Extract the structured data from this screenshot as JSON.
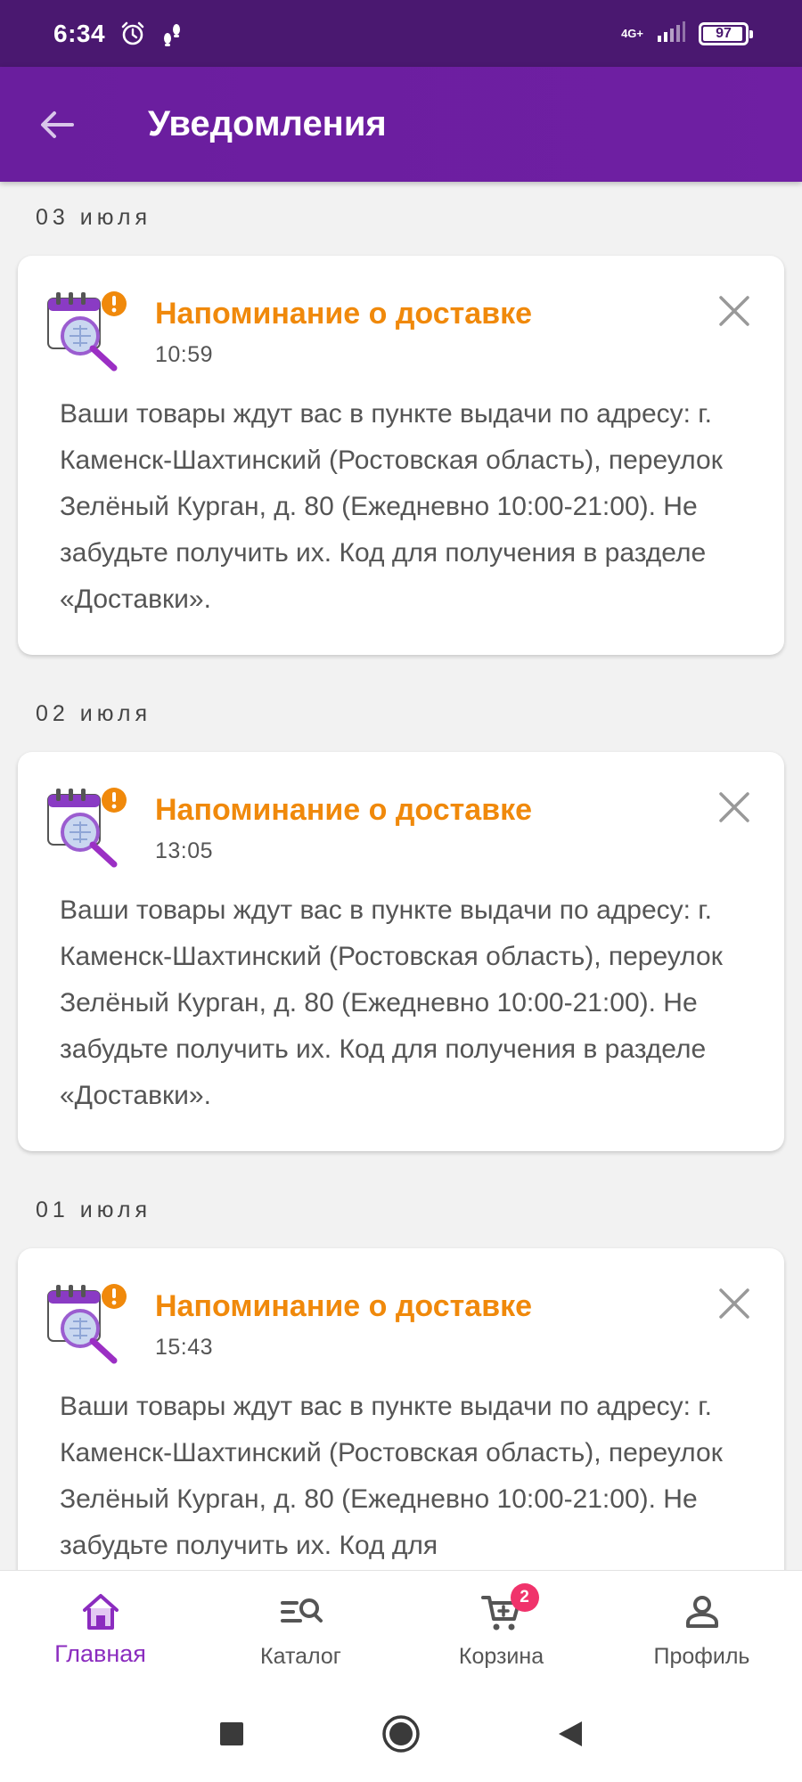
{
  "status_bar": {
    "time": "6:34",
    "network": "4G+",
    "battery": "97",
    "icons": [
      "alarm-icon",
      "footsteps-icon",
      "signal-icon",
      "battery-icon"
    ]
  },
  "app_bar": {
    "title": "Уведомления",
    "back_icon": "arrow-left-icon"
  },
  "colors": {
    "primary": "#6a1e9e",
    "accent_orange": "#f0890b",
    "active_nav": "#8b2cbf",
    "badge": "#f0336b"
  },
  "notifications": [
    {
      "date": "03 июля",
      "title": "Напоминание о доставке",
      "time": "10:59",
      "body": "Ваши товары ждут вас в пункте выдачи по адресу: г. Каменск-Шахтинский (Ростовская область), переулок Зелёный Курган, д. 80 (Ежедневно 10:00-21:00). Не забудьте получить их. Код для получения в разделе «Доставки»."
    },
    {
      "date": "02 июля",
      "title": "Напоминание о доставке",
      "time": "13:05",
      "body": "Ваши товары ждут вас в пункте выдачи по адресу: г. Каменск-Шахтинский (Ростовская область), переулок Зелёный Курган, д. 80 (Ежедневно 10:00-21:00). Не забудьте получить их. Код для получения в разделе «Доставки»."
    },
    {
      "date": "01 июля",
      "title": "Напоминание о доставке",
      "time": "15:43",
      "body": "Ваши товары ждут вас в пункте выдачи по адресу: г. Каменск-Шахтинский (Ростовская область), переулок Зелёный Курган, д. 80 (Ежедневно 10:00-21:00). Не забудьте получить их. Код для"
    }
  ],
  "bottom_nav": {
    "items": [
      {
        "label": "Главная",
        "icon": "home-icon",
        "active": true
      },
      {
        "label": "Каталог",
        "icon": "catalog-search-icon",
        "active": false
      },
      {
        "label": "Корзина",
        "icon": "cart-icon",
        "active": false,
        "badge": "2"
      },
      {
        "label": "Профиль",
        "icon": "profile-icon",
        "active": false
      }
    ]
  },
  "system_nav": [
    "recents-square-icon",
    "home-circle-icon",
    "back-triangle-icon"
  ]
}
